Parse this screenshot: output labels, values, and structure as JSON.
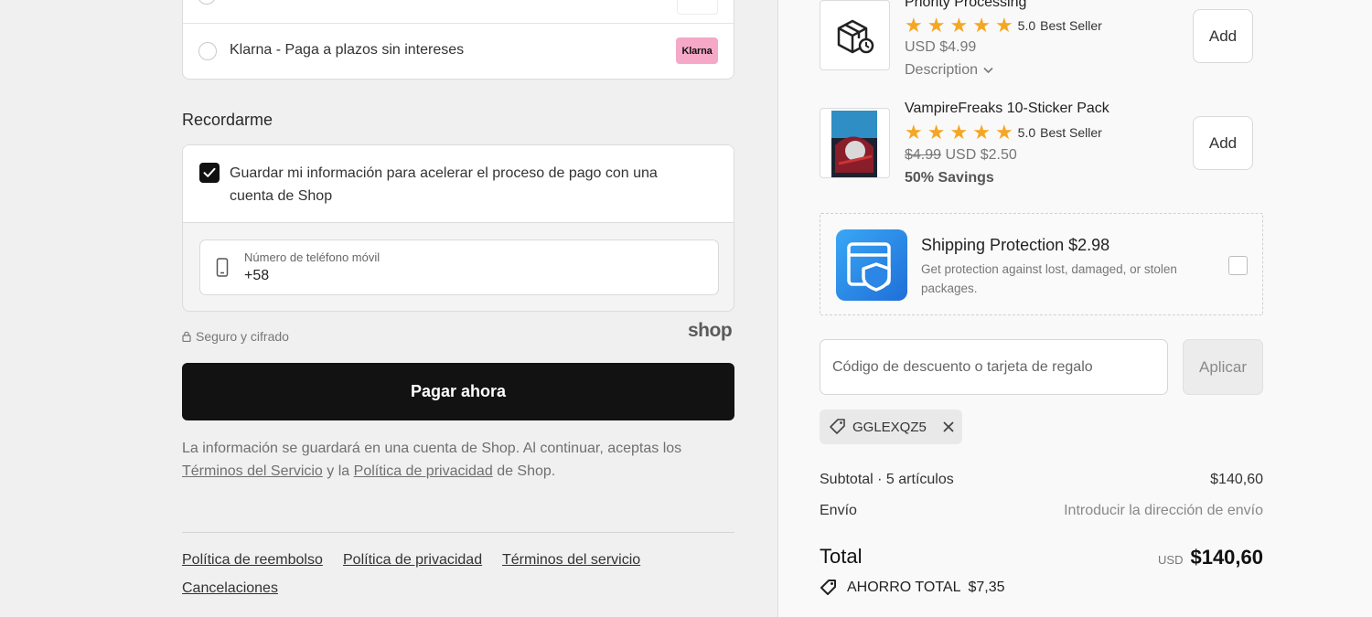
{
  "payment": {
    "options": [
      {
        "label": "Klarna - Paga a plazos sin intereses",
        "badge": "Klarna"
      }
    ]
  },
  "remember": {
    "title": "Recordarme",
    "checkbox_label": "Guardar mi información para acelerar el proceso de pago con una cuenta de Shop",
    "checked": true,
    "phone_label": "Número de teléfono móvil",
    "phone_value": "+58"
  },
  "secure_text": "Seguro y cifrado",
  "shop_logo": "shop",
  "pay_button": "Pagar ahora",
  "legal": {
    "text1": "La información se guardará en una cuenta de Shop. Al continuar, aceptas los",
    "terms_link": "Términos del Servicio",
    "and": "y la",
    "privacy_link": "Política de privacidad",
    "text2": "de Shop."
  },
  "footer": {
    "links": [
      "Política de reembolso",
      "Política de privacidad",
      "Términos del servicio",
      "Cancelaciones"
    ]
  },
  "products": [
    {
      "name": "Priority Processing",
      "rating": "5.0",
      "badge": "Best Seller",
      "price": "USD $4.99",
      "description_label": "Description",
      "add_label": "Add",
      "icon": "package-clock-icon"
    },
    {
      "name": "VampireFreaks 10-Sticker Pack",
      "rating": "5.0",
      "badge": "Best Seller",
      "old_price": "$4.99",
      "price": "USD $2.50",
      "savings": "50% Savings",
      "add_label": "Add"
    }
  ],
  "shipping_protection": {
    "title": "Shipping Protection $2.98",
    "description": "Get protection against lost, damaged, or stolen packages.",
    "checked": false
  },
  "discount": {
    "placeholder": "Código de descuento o tarjeta de regalo",
    "apply_label": "Aplicar",
    "applied_code": "GGLEXQZ5"
  },
  "summary": {
    "subtotal_label": "Subtotal · 5 artículos",
    "subtotal_value": "$140,60",
    "shipping_label": "Envío",
    "shipping_value": "Introducir la dirección de envío",
    "total_label": "Total",
    "total_currency": "USD",
    "total_value": "$140,60",
    "savings_label": "AHORRO TOTAL",
    "savings_value": "$7,35"
  },
  "colors": {
    "primary_button": "#121212",
    "star": "#f5a623",
    "klarna_pink": "#f5a8c8",
    "shipping_blue": "#1f6fd8"
  }
}
